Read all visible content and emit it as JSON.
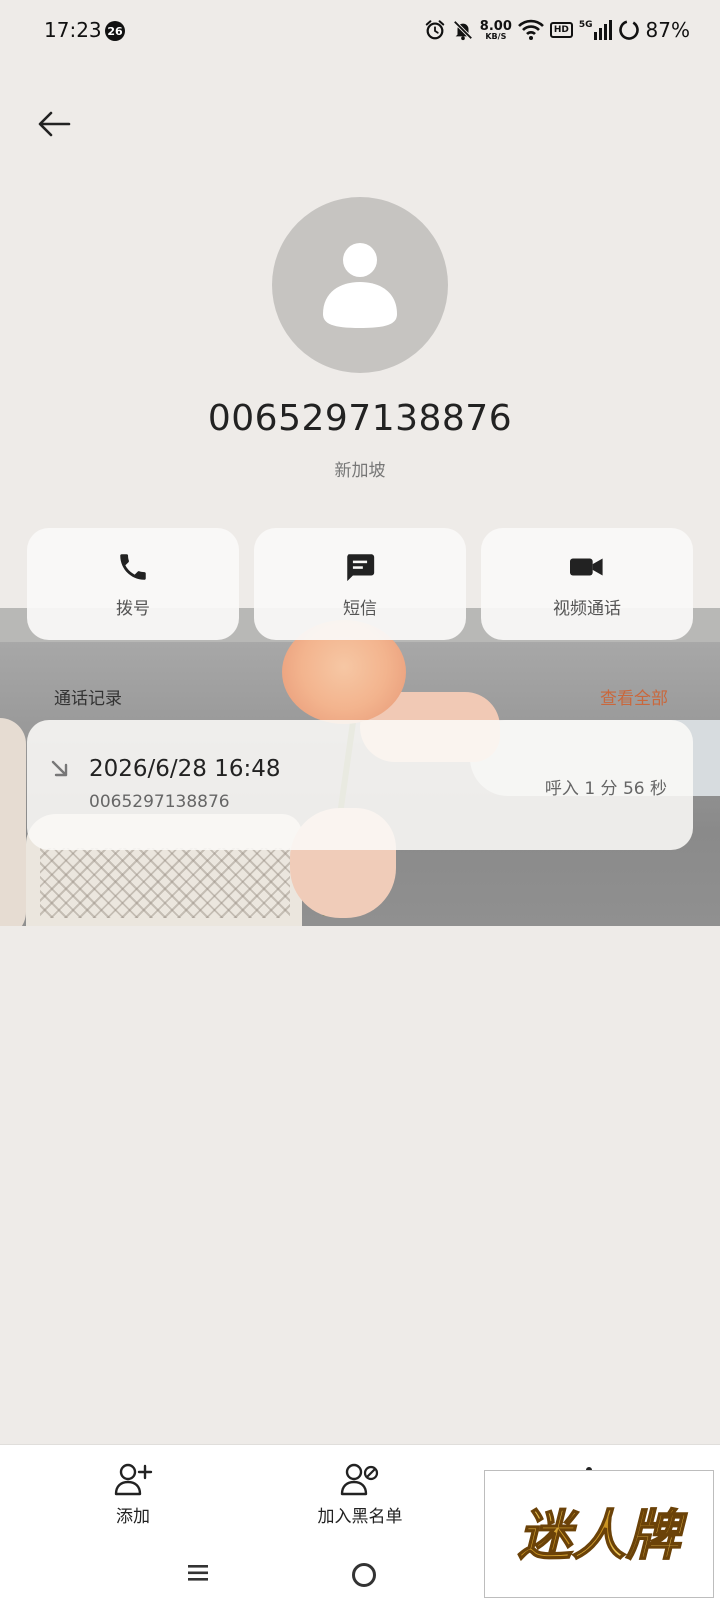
{
  "status_bar": {
    "time": "17:23",
    "notification_count": "26",
    "net_speed_value": "8.00",
    "net_speed_unit": "KB/S",
    "hd_label": "HD",
    "network_type": "5G",
    "battery_percent": "87%"
  },
  "contact": {
    "number": "0065297138876",
    "region": "新加坡"
  },
  "actions": {
    "dial_label": "拨号",
    "sms_label": "短信",
    "video_label": "视频通话"
  },
  "call_log": {
    "title": "通话记录",
    "view_all_label": "查看全部",
    "entries": [
      {
        "datetime": "2026/6/28 16:48",
        "number": "0065297138876",
        "detail": "呼入  1 分 56 秒",
        "direction": "incoming"
      }
    ]
  },
  "bottom_bar": {
    "add_label": "添加",
    "block_label": "加入黑名单"
  },
  "watermark": {
    "text": "迷人牌"
  },
  "colors": {
    "background": "#eeebe8",
    "accent": "#c9683d",
    "avatar_bg": "#c6c4c1",
    "card_bg": "#faf9f7"
  },
  "icons": {
    "back": "arrow-left-icon",
    "dial": "phone-icon",
    "sms": "message-icon",
    "video": "video-camera-icon",
    "incoming_call": "incoming-arrow-icon",
    "add": "add-person-icon",
    "block": "block-person-icon"
  }
}
